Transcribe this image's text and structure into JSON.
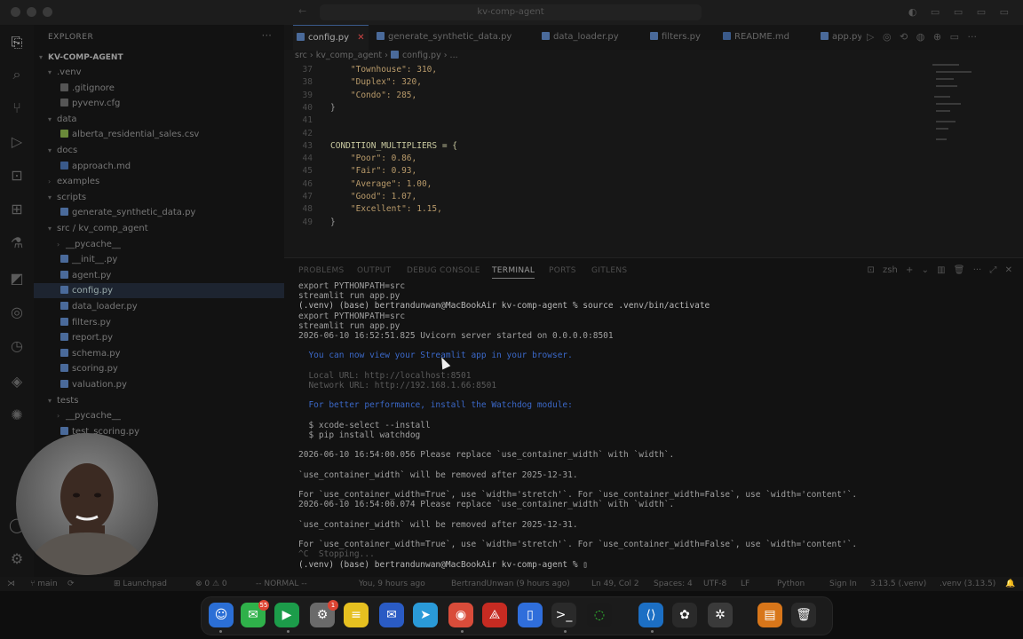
{
  "titlebar": {
    "search": "kv-comp-agent"
  },
  "sidebar": {
    "title": "EXPLORER",
    "project": "KV-COMP-AGENT",
    "items": [
      {
        "label": ".venv",
        "depth": 1,
        "type": "folder",
        "open": true
      },
      {
        "label": ".gitignore",
        "depth": 2,
        "type": "file"
      },
      {
        "label": "pyvenv.cfg",
        "depth": 2,
        "type": "file"
      },
      {
        "label": "data",
        "depth": 1,
        "type": "folder",
        "open": true
      },
      {
        "label": "alberta_residential_sales.csv",
        "depth": 2,
        "type": "csv"
      },
      {
        "label": "docs",
        "depth": 1,
        "type": "folder",
        "open": true
      },
      {
        "label": "approach.md",
        "depth": 2,
        "type": "md"
      },
      {
        "label": "examples",
        "depth": 1,
        "type": "folder",
        "open": false
      },
      {
        "label": "scripts",
        "depth": 1,
        "type": "folder",
        "open": true
      },
      {
        "label": "generate_synthetic_data.py",
        "depth": 2,
        "type": "py"
      },
      {
        "label": "src / kv_comp_agent",
        "depth": 1,
        "type": "folder",
        "open": true
      },
      {
        "label": "__pycache__",
        "depth": 2,
        "type": "folder",
        "open": false
      },
      {
        "label": "__init__.py",
        "depth": 2,
        "type": "py"
      },
      {
        "label": "agent.py",
        "depth": 2,
        "type": "py"
      },
      {
        "label": "config.py",
        "depth": 2,
        "type": "py",
        "active": true
      },
      {
        "label": "data_loader.py",
        "depth": 2,
        "type": "py"
      },
      {
        "label": "filters.py",
        "depth": 2,
        "type": "py"
      },
      {
        "label": "report.py",
        "depth": 2,
        "type": "py"
      },
      {
        "label": "schema.py",
        "depth": 2,
        "type": "py"
      },
      {
        "label": "scoring.py",
        "depth": 2,
        "type": "py"
      },
      {
        "label": "valuation.py",
        "depth": 2,
        "type": "py"
      },
      {
        "label": "tests",
        "depth": 1,
        "type": "folder",
        "open": true
      },
      {
        "label": "__pycache__",
        "depth": 2,
        "type": "folder",
        "open": false
      },
      {
        "label": "test_scoring.py",
        "depth": 2,
        "type": "py"
      }
    ]
  },
  "editor": {
    "tabs": [
      {
        "label": "config.py",
        "active": true,
        "close": "✕"
      },
      {
        "label": "generate_synthetic_data.py"
      },
      {
        "label": "data_loader.py"
      },
      {
        "label": "filters.py"
      },
      {
        "label": "README.md"
      },
      {
        "label": "app.py"
      }
    ],
    "breadcrumb": [
      "src",
      "kv_comp_agent",
      "config.py",
      "..."
    ],
    "lines": [
      {
        "n": "37",
        "text": "    \"Townhouse\": 310,"
      },
      {
        "n": "38",
        "text": "    \"Duplex\": 320,"
      },
      {
        "n": "39",
        "text": "    \"Condo\": 285,"
      },
      {
        "n": "40",
        "text": "}"
      },
      {
        "n": "41",
        "text": ""
      },
      {
        "n": "42",
        "text": ""
      },
      {
        "n": "43",
        "text": "CONDITION_MULTIPLIERS = {"
      },
      {
        "n": "44",
        "text": "    \"Poor\": 0.86,"
      },
      {
        "n": "45",
        "text": "    \"Fair\": 0.93,"
      },
      {
        "n": "46",
        "text": "    \"Average\": 1.00,"
      },
      {
        "n": "47",
        "text": "    \"Good\": 1.07,"
      },
      {
        "n": "48",
        "text": "    \"Excellent\": 1.15,"
      },
      {
        "n": "49",
        "text": "}"
      }
    ]
  },
  "panel": {
    "tabs": [
      "PROBLEMS",
      "OUTPUT",
      "DEBUG CONSOLE",
      "TERMINAL",
      "PORTS",
      "GITLENS"
    ],
    "active_tab": "TERMINAL",
    "shell": "zsh",
    "lines": [
      {
        "text": "export PYTHONPATH=src",
        "style": ""
      },
      {
        "text": "streamlit run app.py",
        "style": ""
      },
      {
        "text": "(.venv) (base) bertrandunwan@MacBookAir kv-comp-agent % source .venv/bin/activate",
        "style": "bold"
      },
      {
        "text": "export PYTHONPATH=src",
        "style": ""
      },
      {
        "text": "streamlit run app.py",
        "style": ""
      },
      {
        "text": "2026-06-10 16:52:51.825 Uvicorn server started on 0.0.0.0:8501",
        "style": ""
      },
      {
        "text": "",
        "style": ""
      },
      {
        "text": "  You can now view your Streamlit app in your browser.",
        "style": "blue"
      },
      {
        "text": "",
        "style": ""
      },
      {
        "text": "  Local URL: http://localhost:8501",
        "style": "faint"
      },
      {
        "text": "  Network URL: http://192.168.1.66:8501",
        "style": "faint"
      },
      {
        "text": "",
        "style": ""
      },
      {
        "text": "  For better performance, install the Watchdog module:",
        "style": "blue"
      },
      {
        "text": "",
        "style": ""
      },
      {
        "text": "  $ xcode-select --install",
        "style": ""
      },
      {
        "text": "  $ pip install watchdog",
        "style": ""
      },
      {
        "text": "",
        "style": ""
      },
      {
        "text": "2026-06-10 16:54:00.056 Please replace `use_container_width` with `width`.",
        "style": ""
      },
      {
        "text": "",
        "style": ""
      },
      {
        "text": "`use_container_width` will be removed after 2025-12-31.",
        "style": ""
      },
      {
        "text": "",
        "style": ""
      },
      {
        "text": "For `use_container_width=True`, use `width='stretch'`. For `use_container_width=False`, use `width='content'`.",
        "style": ""
      },
      {
        "text": "2026-06-10 16:54:00.074 Please replace `use_container_width` with `width`.",
        "style": ""
      },
      {
        "text": "",
        "style": ""
      },
      {
        "text": "`use_container_width` will be removed after 2025-12-31.",
        "style": ""
      },
      {
        "text": "",
        "style": ""
      },
      {
        "text": "For `use_container_width=True`, use `width='stretch'`. For `use_container_width=False`, use `width='content'`.",
        "style": ""
      },
      {
        "text": "^C  Stopping...",
        "style": "faint"
      },
      {
        "text": "(.venv) (base) bertrandunwan@MacBookAir kv-comp-agent % ▯",
        "style": "bold"
      }
    ]
  },
  "statusbar": {
    "branch": "main",
    "launchpad": "Launchpad",
    "problems": "⊗ 0 ⚠ 0",
    "mode": "-- NORMAL --",
    "blame": "You, 9 hours ago",
    "author": "BertrandUnwan (9 hours ago)",
    "position": "Ln 49, Col 2",
    "spaces": "Spaces: 4",
    "encoding": "UTF-8",
    "eol": "LF",
    "language": "Python",
    "signin": "Sign In",
    "interpreter": "3.13.5 (.venv)",
    "venv": ".venv (3.13.5)"
  },
  "dock": {
    "messages_badge": "55",
    "settings_badge": "1"
  }
}
